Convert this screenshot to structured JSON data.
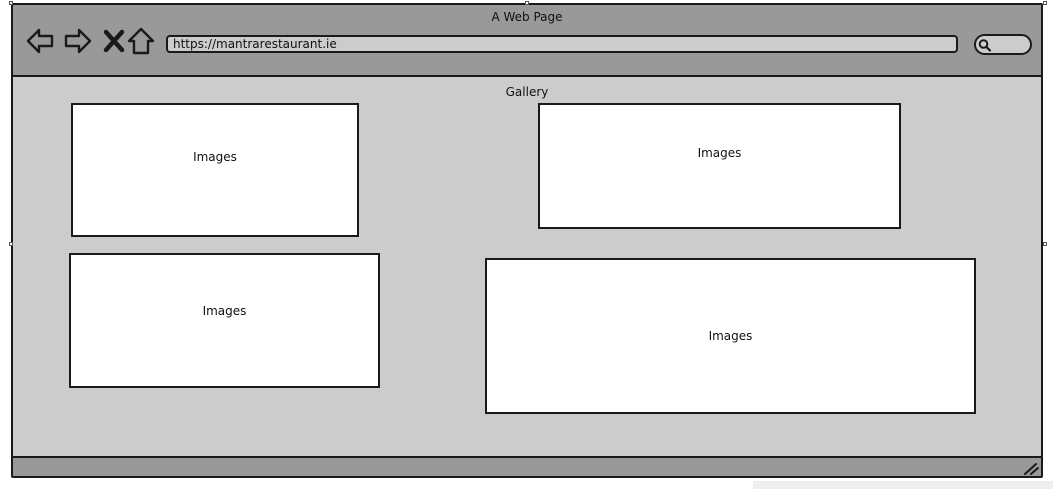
{
  "window": {
    "title": "A Web Page"
  },
  "toolbar": {
    "back_icon": "arrow-left-icon",
    "forward_icon": "arrow-right-icon",
    "stop_icon": "close-icon",
    "home_icon": "home-icon",
    "search_icon": "search-icon"
  },
  "address_bar": {
    "url": "https://mantrarestaurant.ie"
  },
  "page": {
    "heading": "Gallery",
    "images": [
      {
        "label": "Images"
      },
      {
        "label": "Images"
      },
      {
        "label": "Images"
      },
      {
        "label": "Images"
      }
    ]
  },
  "colors": {
    "chrome": "#999999",
    "content_background": "#cccccc",
    "outline": "#1a1a1a",
    "placeholder_fill": "#ffffff"
  }
}
